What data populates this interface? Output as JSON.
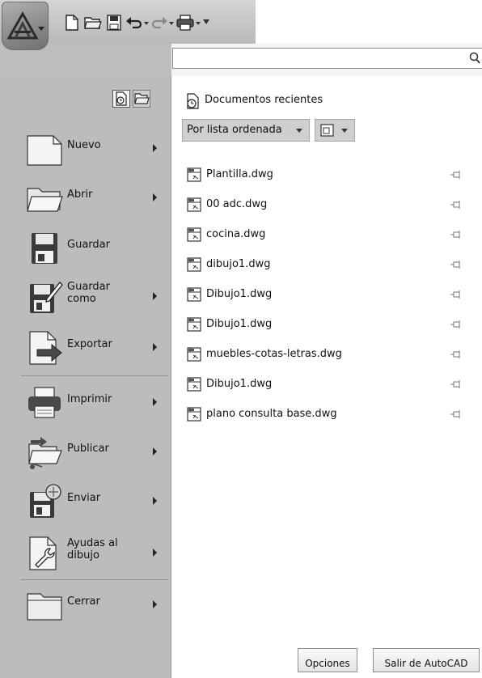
{
  "search": {
    "placeholder": "",
    "value": ""
  },
  "recent_panel": {
    "title": "Documentos recientes",
    "sort_selected": "Por lista ordenada",
    "icon_size_icon": "large-icons-view-icon"
  },
  "files": [
    {
      "name": "Plantilla.dwg"
    },
    {
      "name": "00 adc.dwg"
    },
    {
      "name": "cocina.dwg"
    },
    {
      "name": "dibujo1.dwg"
    },
    {
      "name": "Dibujo1.dwg"
    },
    {
      "name": "Dibujo1.dwg"
    },
    {
      "name": "muebles-cotas-letras.dwg"
    },
    {
      "name": "Dibujo1.dwg"
    },
    {
      "name": "plano consulta base.dwg"
    }
  ],
  "menu": {
    "new": "Nuevo",
    "open": "Abrir",
    "save": "Guardar",
    "save_as": "Guardar\ncomo",
    "export": "Exportar",
    "print": "Imprimir",
    "publish": "Publicar",
    "send": "Enviar",
    "drawing_utilities": "Ayudas al\ndibujo",
    "close": "Cerrar"
  },
  "footer": {
    "options_label": "Opciones",
    "exit_label": "Salir de AutoCAD"
  },
  "icons": {
    "app": "autocad-app-icon",
    "qat": [
      "new-document-icon",
      "open-folder-icon",
      "save-disk-icon",
      "undo-icon",
      "redo-icon",
      "print-icon",
      "customize-dropdown-icon"
    ],
    "view_toggles": [
      "recent-documents-icon",
      "open-documents-icon"
    ],
    "file": "dwg-file-icon",
    "pin": "pin-icon",
    "search": "search-icon"
  },
  "colors": {
    "menu_bg": "#bcbcbc",
    "panel_bg": "#ffffff",
    "toolbar_bg": "#c8c8c8"
  }
}
